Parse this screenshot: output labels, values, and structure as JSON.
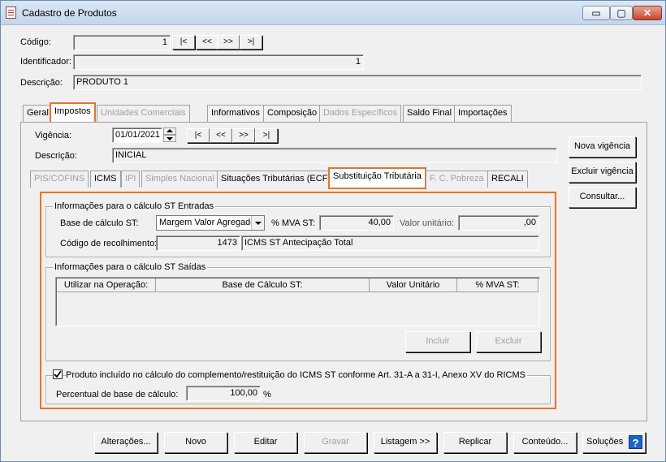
{
  "window": {
    "title": "Cadastro de Produtos",
    "minimize": "▭",
    "restore": "▢",
    "close": "✕"
  },
  "header": {
    "codigo_label": "Código:",
    "codigo_value": "1",
    "identificador_label": "Identificador:",
    "identificador_value": "1",
    "descricao_label": "Descrição:",
    "descricao_value": "PRODUTO 1",
    "nav": [
      "|<",
      "<<",
      ">>",
      ">|"
    ]
  },
  "tabs": [
    "Geral",
    "Impostos",
    "Unidades Comerciais",
    "Informativos",
    "Composição",
    "Dados Específicos",
    "Saldo Final",
    "Importações"
  ],
  "vigencia": {
    "label": "Vigência:",
    "value": "01/01/2021",
    "nav": [
      "|<",
      "<<",
      ">>",
      ">|"
    ],
    "descricao_label": "Descrição:",
    "descricao_value": "INICIAL"
  },
  "subtabs": [
    "PIS/COFINS",
    "ICMS",
    "IPI",
    "Simples Nacional",
    "Situações Tributárias (ECF)",
    "Substituição Tributária",
    "F. C. Pobreza",
    "RECALI"
  ],
  "side_buttons": [
    "Nova vigência",
    "Excluir vigência",
    "Consultar..."
  ],
  "entradas": {
    "title": "Informações para o cálculo ST Entradas",
    "base_label": "Base de cálculo ST:",
    "base_value": "Margem Valor Agregado",
    "mva_label": "% MVA ST:",
    "mva_value": "40,00",
    "valor_label": "Valor unitário:",
    "valor_value": ",00",
    "codigo_label": "Código de recolhimento:",
    "codigo_value": "1473",
    "codigo_desc": "ICMS ST Antecipação Total"
  },
  "saidas": {
    "title": "Informações para o cálculo ST Saídas",
    "columns": [
      "Utilizar na Operação:",
      "Base de Cálculo ST:",
      "Valor Unitário",
      "% MVA ST:"
    ],
    "incluir": "Incluir",
    "excluir": "Excluir"
  },
  "complemento": {
    "checkbox_label": "Produto incluído no cálculo do complemento/restituição do ICMS ST conforme Art. 31-A a 31-I, Anexo XV do RICMS",
    "percentual_label": "Percentual de base de cálculo:",
    "percentual_value": "100,00",
    "percent_sign": "%"
  },
  "footer": [
    "Alterações...",
    "Novo",
    "Editar",
    "Gravar",
    "Listagem >>",
    "Replicar",
    "Conteúdo...",
    "Soluções"
  ],
  "help_glyph": "?",
  "colors": {
    "highlight": "#e8732a",
    "help": "#1b64c8"
  }
}
